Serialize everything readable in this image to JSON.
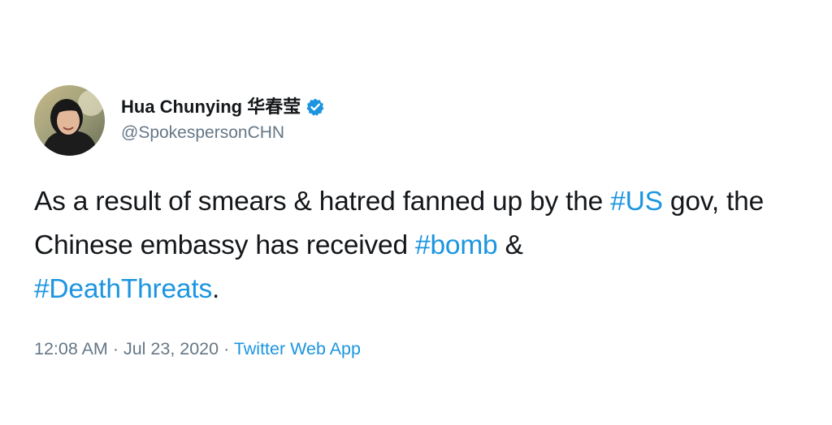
{
  "author": {
    "display_name": "Hua Chunying 华春莹",
    "handle": "@SpokespersonCHN",
    "verified_icon": "verified-badge-icon",
    "accent_color": "#1b95e0"
  },
  "tweet": {
    "text_1": "As a result of smears & hatred fanned up by the ",
    "hashtag_1": "#US",
    "text_2": " gov, the Chinese embassy has received ",
    "hashtag_2": "#bomb",
    "text_3": " & ",
    "hashtag_3": "#DeathThreats",
    "text_4": "."
  },
  "meta": {
    "time": "12:08 AM",
    "separator_1": " · ",
    "date": "Jul 23, 2020",
    "separator_2": " · ",
    "source": "Twitter Web App"
  }
}
